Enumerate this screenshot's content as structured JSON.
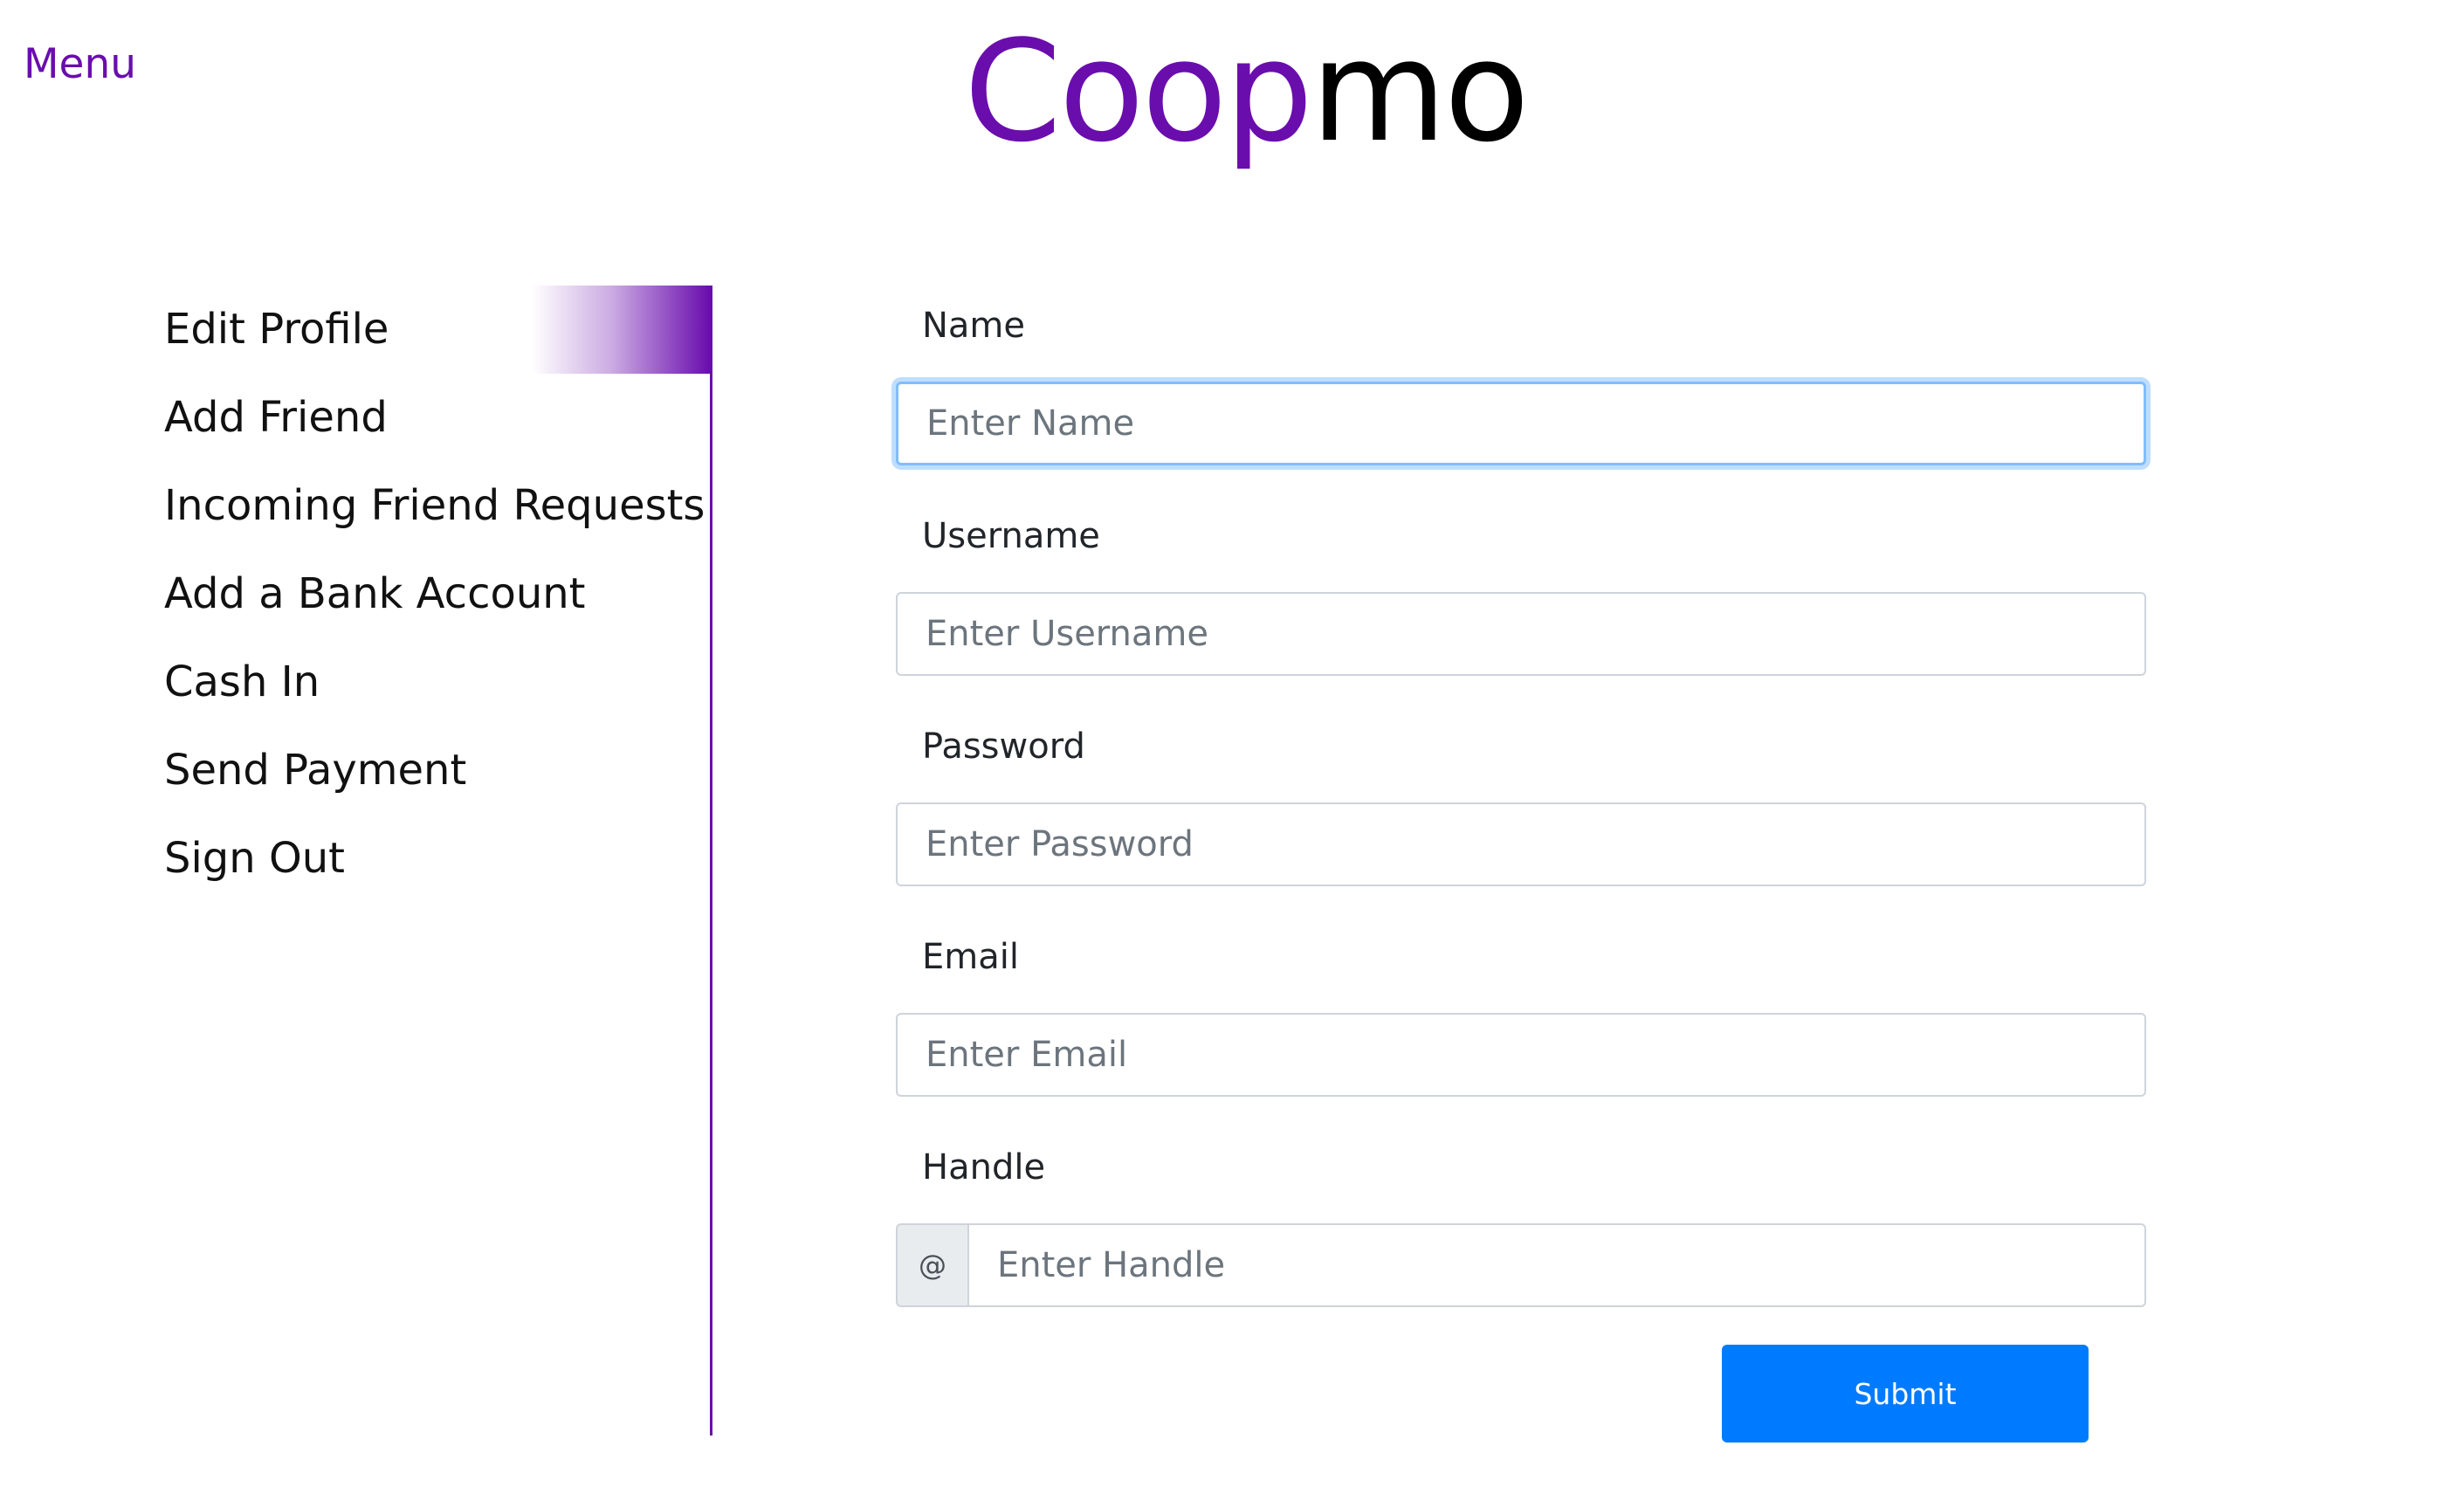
{
  "header": {
    "menu_label": "Menu",
    "logo_part1": "Coop",
    "logo_part2": "mo"
  },
  "colors": {
    "brand_purple": "#6a0dad",
    "primary_button": "#007bff",
    "focus_border": "#80bdff"
  },
  "sidebar": {
    "active_item": "Edit Profile",
    "items": [
      {
        "label": "Edit Profile"
      },
      {
        "label": "Add Friend"
      },
      {
        "label": "Incoming Friend Requests"
      },
      {
        "label": "Add a Bank Account"
      },
      {
        "label": "Cash In"
      },
      {
        "label": "Send Payment"
      },
      {
        "label": "Sign Out"
      }
    ]
  },
  "form": {
    "name": {
      "label": "Name",
      "placeholder": "Enter Name",
      "value": ""
    },
    "username": {
      "label": "Username",
      "placeholder": "Enter Username",
      "value": ""
    },
    "password": {
      "label": "Password",
      "placeholder": "Enter Password",
      "value": ""
    },
    "email": {
      "label": "Email",
      "placeholder": "Enter Email",
      "value": ""
    },
    "handle": {
      "label": "Handle",
      "prefix": "@",
      "placeholder": "Enter Handle",
      "value": ""
    },
    "submit_label": "Submit"
  }
}
